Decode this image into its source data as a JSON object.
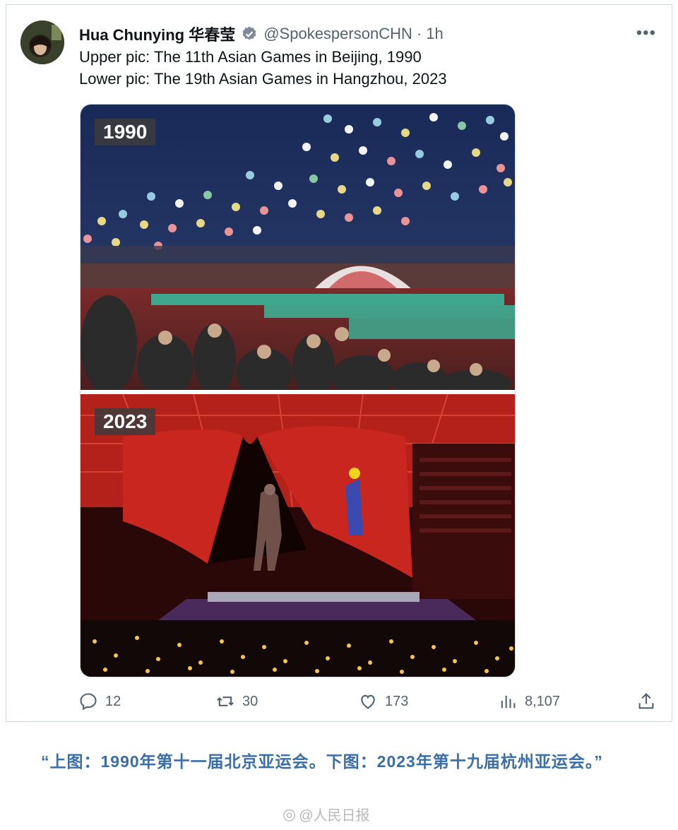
{
  "tweet": {
    "author_name": "Hua Chunying 华春莹",
    "handle": "@SpokespersonCHN",
    "separator": "·",
    "time": "1h",
    "more_icon": "more-horizontal-icon",
    "verified_icon": "verified-badge-icon",
    "text_lines": [
      "Upper pic: The 11th Asian Games in Beijing, 1990",
      "Lower pic: The 19th Asian Games in Hangzhou, 2023"
    ],
    "media": {
      "top_label": "1990",
      "bottom_label": "2023"
    },
    "actions": {
      "reply": {
        "icon": "reply-icon",
        "count": "12"
      },
      "retweet": {
        "icon": "retweet-icon",
        "count": "30"
      },
      "like": {
        "icon": "heart-icon",
        "count": "173"
      },
      "views": {
        "icon": "views-chart-icon",
        "count": "8,107"
      },
      "share": {
        "icon": "share-icon"
      }
    }
  },
  "caption": "“上图：1990年第十一届北京亚运会。下图：2023年第十九届杭州亚运会。”",
  "watermark": "@人民日报",
  "colors": {
    "caption_blue": "#3a6ea8",
    "text_primary": "#0f1419",
    "text_secondary": "#536471",
    "border": "#cfd9de"
  }
}
